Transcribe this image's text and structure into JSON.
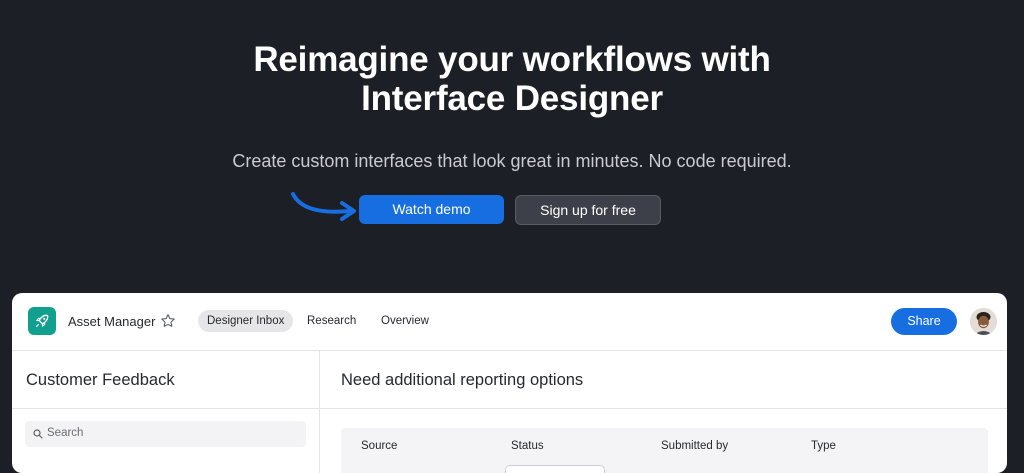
{
  "hero": {
    "title_line1": "Reimagine your workflows with",
    "title_line2": "Interface Designer",
    "subtitle": "Create custom interfaces that look great in minutes. No code required.",
    "primary_button": "Watch demo",
    "secondary_button": "Sign up for free",
    "accent_color": "#166ee1"
  },
  "app": {
    "name": "Asset Manager",
    "tabs": [
      {
        "label": "Designer Inbox",
        "active": true
      },
      {
        "label": "Research",
        "active": false
      },
      {
        "label": "Overview",
        "active": false
      }
    ],
    "share_label": "Share",
    "sidebar": {
      "title": "Customer Feedback",
      "search_placeholder": "Search"
    },
    "main": {
      "title": "Need additional reporting options",
      "columns": [
        "Source",
        "Status",
        "Submitted by",
        "Type"
      ]
    }
  }
}
